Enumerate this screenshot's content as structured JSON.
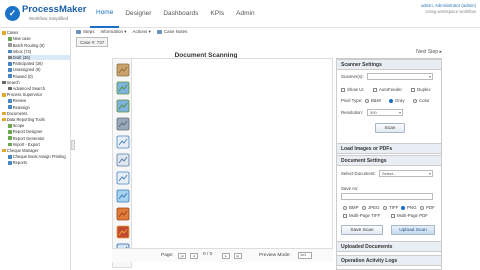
{
  "header": {
    "logo_name": "ProcessMaker",
    "logo_tag": "Workflow Simplified",
    "nav": [
      {
        "label": "Home",
        "active": true
      },
      {
        "label": "Designer",
        "active": false
      },
      {
        "label": "Dashboards",
        "active": false
      },
      {
        "label": "KPIs",
        "active": false
      },
      {
        "label": "Admin",
        "active": false
      }
    ],
    "user_line1": "admin, Administrator (admin)",
    "user_line2": "Using workspace workflow"
  },
  "sidebar": {
    "items": [
      {
        "label": "Cases",
        "indent": 0,
        "color": "#e0a832"
      },
      {
        "label": "New case",
        "indent": 1,
        "color": "#6aa84f"
      },
      {
        "label": "Batch Routing (0)",
        "indent": 1,
        "color": "#999999"
      },
      {
        "label": "Inbox (74)",
        "indent": 1,
        "color": "#4a86c5"
      },
      {
        "label": "Draft (36)",
        "indent": 1,
        "color": "#7f7f7f",
        "selected": true
      },
      {
        "label": "Participated (36)",
        "indent": 1,
        "color": "#4a86c5"
      },
      {
        "label": "Unassigned (9)",
        "indent": 1,
        "color": "#4a86c5"
      },
      {
        "label": "Paused (0)",
        "indent": 1,
        "color": "#4a86c5"
      },
      {
        "label": "Search",
        "indent": 0,
        "color": "#666666"
      },
      {
        "label": "Advanced Search",
        "indent": 1,
        "color": "#666666"
      },
      {
        "label": "Process Supervisor",
        "indent": 0,
        "color": "#e0a832"
      },
      {
        "label": "Review",
        "indent": 1,
        "color": "#4a86c5"
      },
      {
        "label": "Reassign",
        "indent": 1,
        "color": "#4a86c5"
      },
      {
        "label": "Documents",
        "indent": 0,
        "color": "#e0a832"
      },
      {
        "label": "Data Reporting Tools",
        "indent": 0,
        "color": "#e0a832"
      },
      {
        "label": "Scope",
        "indent": 1,
        "color": "#6aa84f"
      },
      {
        "label": "Report Designer",
        "indent": 1,
        "color": "#6aa84f"
      },
      {
        "label": "Report Generator",
        "indent": 1,
        "color": "#6aa84f"
      },
      {
        "label": "Import - Export",
        "indent": 1,
        "color": "#6aa84f"
      },
      {
        "label": "Cheque Manager",
        "indent": 0,
        "color": "#e0a832"
      },
      {
        "label": "Cheque Book Assign Printing",
        "indent": 1,
        "color": "#4a86c5"
      },
      {
        "label": "Reports",
        "indent": 1,
        "color": "#4a86c5"
      }
    ]
  },
  "toolbar": {
    "steps": "Steps",
    "information": "Information",
    "actions": "Actions",
    "case_notes": "Case Notes",
    "case_tab": "Case #: 737"
  },
  "main": {
    "title": "Document Scanning",
    "next_step": "Next Step",
    "thumb_icons": [
      "scanner-icon",
      "landscape-icon",
      "landscape-icon",
      "gears-icon",
      "page-icon",
      "ruler-icon",
      "page-icon",
      "flask-icon",
      "toolbox-icon",
      "image-icon",
      "fit-icon"
    ],
    "pager": {
      "page_label": "Page:",
      "page_value": "0 / 0",
      "mode_label": "Preview Mode:",
      "mode_value": "1x1"
    }
  },
  "panel": {
    "scanner_settings": {
      "title": "Scanner Settings",
      "scanner_label": "Scanner(s):",
      "show_ui": "Show UI",
      "autofeeder": "AutoFeeder",
      "duplex": "Duplex",
      "pixel_type_label": "Pixel Type:",
      "pixel_types": [
        {
          "label": "B&W",
          "checked": false
        },
        {
          "label": "Gray",
          "checked": true
        },
        {
          "label": "Color",
          "checked": false
        }
      ],
      "resolution_label": "Resolution:",
      "resolution_value": "300",
      "scan_button": "Scan"
    },
    "load_images": "Load Images or PDFs",
    "document_settings": {
      "title": "Document Settings",
      "select_doc_label": "Select Document:",
      "select_doc_value": "Select...",
      "save_as_label": "Save As:",
      "formats": [
        {
          "label": "BMP",
          "checked": false
        },
        {
          "label": "JPEG",
          "checked": false
        },
        {
          "label": "TIFF",
          "checked": false
        },
        {
          "label": "PNG",
          "checked": true
        },
        {
          "label": "PDF",
          "checked": false
        }
      ],
      "multi_tiff": "Multi-Page TIFF",
      "multi_pdf": "Multi-Page PDF",
      "save_scan": "Save Scan",
      "upload_scan": "Upload Scan"
    },
    "uploaded_documents": "Uploaded Documents",
    "operation_log": "Operation Activity Logs"
  }
}
